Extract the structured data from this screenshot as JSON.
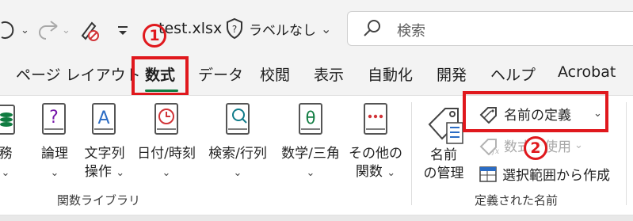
{
  "titlebar": {
    "filename": "test.xlsx",
    "sensitivity_label": "ラベルなし",
    "search_placeholder": "検索"
  },
  "tabs": [
    {
      "label": "ページ レイアウト"
    },
    {
      "label": "数式",
      "active": true
    },
    {
      "label": "データ"
    },
    {
      "label": "校閲"
    },
    {
      "label": "表示"
    },
    {
      "label": "自動化"
    },
    {
      "label": "開発"
    },
    {
      "label": "ヘルプ"
    },
    {
      "label": "Acrobat"
    }
  ],
  "ribbon": {
    "function_library": {
      "group_label": "関数ライブラリ",
      "buttons": [
        {
          "label_line1": "務",
          "label_line2": "",
          "icon": "financial-book-icon"
        },
        {
          "label_line1": "論理",
          "label_line2": "",
          "icon": "logical-book-icon"
        },
        {
          "label_line1": "文字列",
          "label_line2": "操作",
          "icon": "text-book-icon"
        },
        {
          "label_line1": "日付/時刻",
          "label_line2": "",
          "icon": "datetime-book-icon"
        },
        {
          "label_line1": "検索/行列",
          "label_line2": "",
          "icon": "lookup-book-icon"
        },
        {
          "label_line1": "数学/三角",
          "label_line2": "",
          "icon": "math-book-icon"
        },
        {
          "label_line1": "その他の",
          "label_line2": "関数",
          "icon": "more-functions-book-icon"
        }
      ]
    },
    "defined_names": {
      "group_label": "定義された名前",
      "name_manager_line1": "名前",
      "name_manager_line2": "の管理",
      "define_name": "名前の定義",
      "use_in_formula": "数式で使用",
      "create_from_selection": "選択範囲から作成"
    }
  },
  "annotations": {
    "marker1": "1",
    "marker2": "2",
    "highlight_color": "#e0181d"
  },
  "colors": {
    "accent": "#107c41",
    "book_green": "#107c41",
    "book_purple": "#7719aa",
    "book_blue": "#2b6cc4",
    "book_red": "#d13438",
    "book_teal": "#0f7b8a"
  }
}
